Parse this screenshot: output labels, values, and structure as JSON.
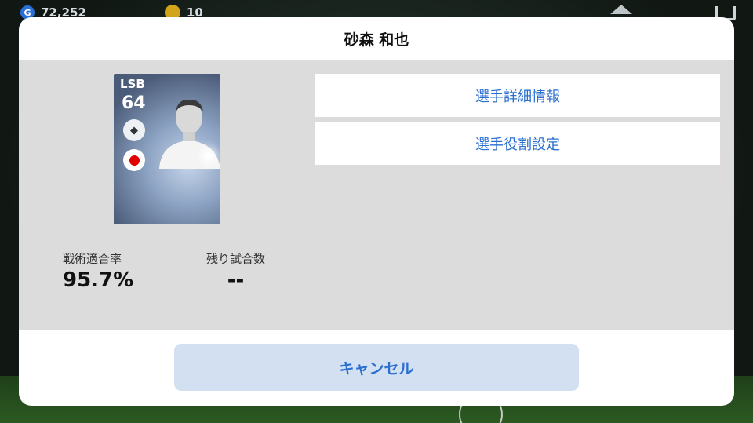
{
  "topbar": {
    "gp_value": "72,252",
    "coin_value": "10"
  },
  "dialog": {
    "title": "砂森 和也",
    "card": {
      "position": "LSB",
      "rating": "64"
    },
    "stats": [
      {
        "label": "戦術適合率",
        "value": "95.7%"
      },
      {
        "label": "残り試合数",
        "value": "--"
      }
    ],
    "menu": [
      {
        "label": "選手詳細情報"
      },
      {
        "label": "選手役割設定"
      }
    ],
    "cancel_label": "キャンセル"
  },
  "colors": {
    "accent": "#2b6fd1",
    "cancel_bg": "#d3e0f1",
    "body_bg": "#dcdcdc"
  }
}
